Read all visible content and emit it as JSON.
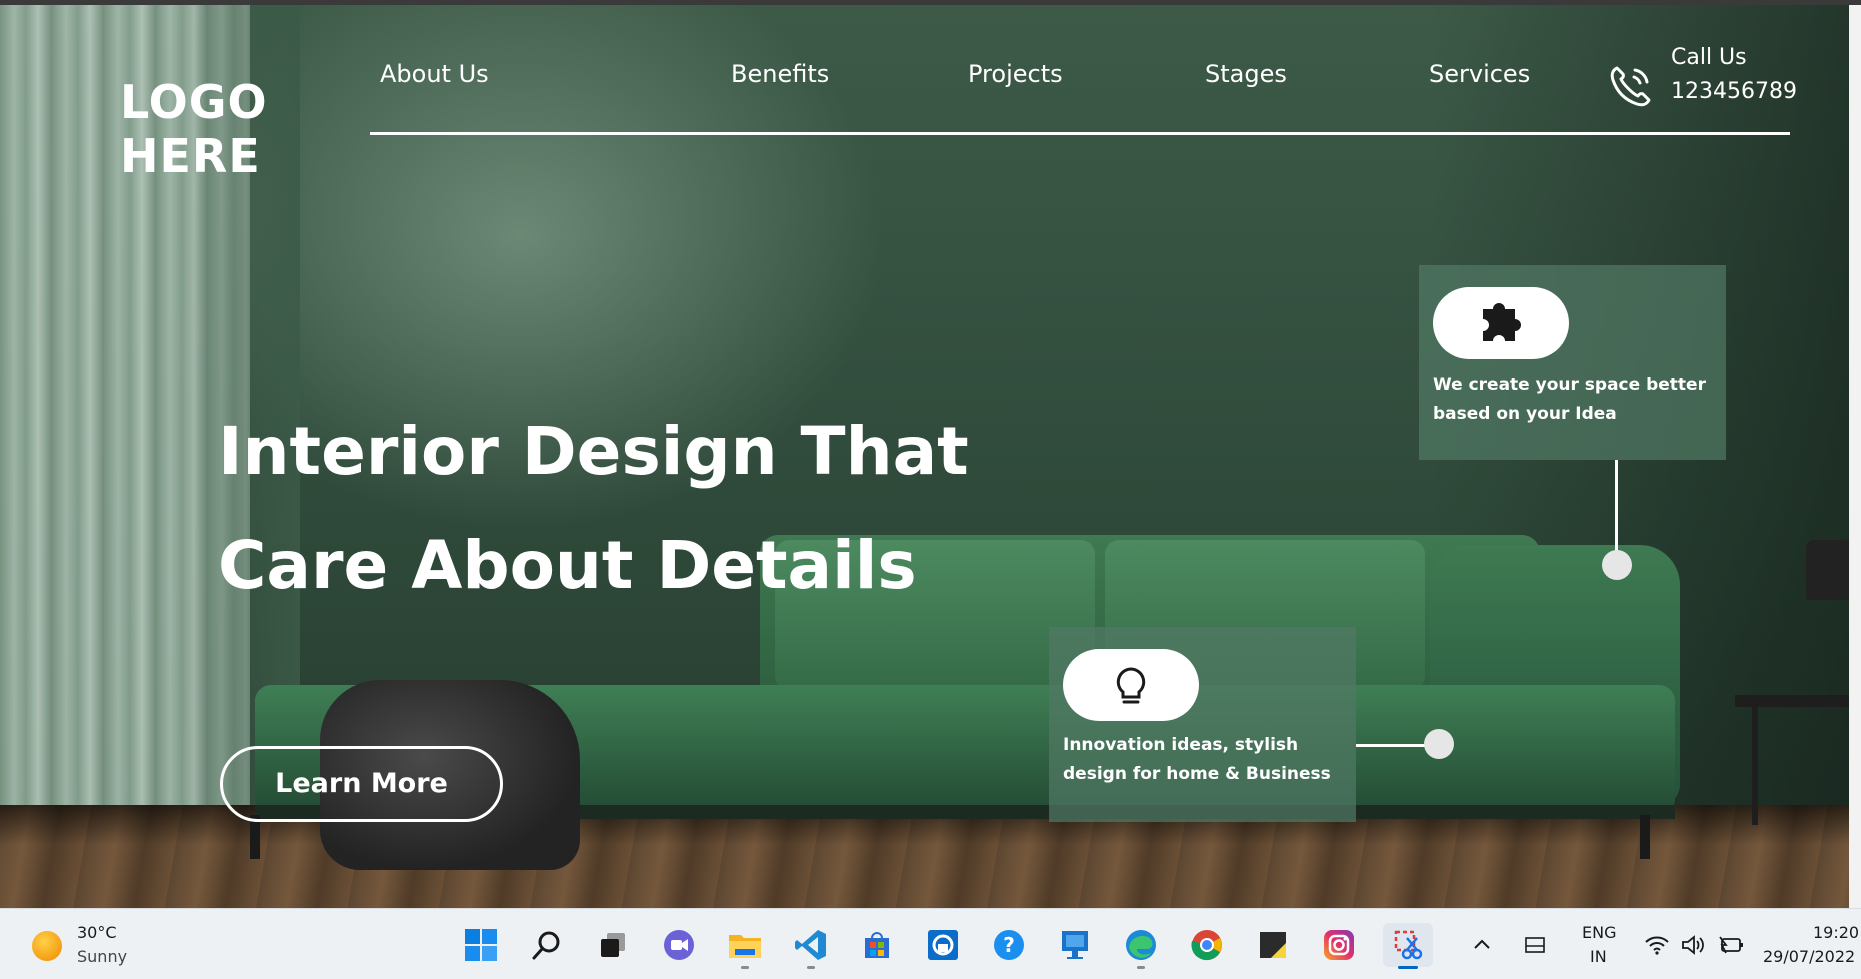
{
  "site": {
    "logo_line1": "LOGO",
    "logo_line2": "HERE",
    "nav": [
      {
        "label": "About Us"
      },
      {
        "label": "Benefits"
      },
      {
        "label": "Projects"
      },
      {
        "label": "Stages"
      },
      {
        "label": "Services"
      }
    ],
    "call": {
      "title": "Call Us",
      "number": "123456789",
      "icon": "phone-icon"
    },
    "headline_line1": "Interior Design That",
    "headline_line2": "Care About Details",
    "cta_label": "Learn More",
    "cards": [
      {
        "icon": "puzzle-icon",
        "text": "We create your space better based on your Idea"
      },
      {
        "icon": "lightbulb-icon",
        "text": "Innovation ideas, stylish design for home & Business"
      }
    ],
    "colors": {
      "accent_card": "#50786480",
      "text": "#ffffff",
      "hero_green": "#3d5a48"
    }
  },
  "taskbar": {
    "weather": {
      "temp": "30°C",
      "condition": "Sunny",
      "icon": "sun-icon"
    },
    "apps": [
      {
        "name": "start-icon"
      },
      {
        "name": "search-icon"
      },
      {
        "name": "task-view-icon"
      },
      {
        "name": "teams-chat-icon"
      },
      {
        "name": "file-explorer-icon"
      },
      {
        "name": "vscode-icon"
      },
      {
        "name": "microsoft-store-icon"
      },
      {
        "name": "remote-app-icon"
      },
      {
        "name": "help-icon"
      },
      {
        "name": "desktop-app-icon"
      },
      {
        "name": "edge-icon"
      },
      {
        "name": "chrome-icon"
      },
      {
        "name": "sticky-notes-icon"
      },
      {
        "name": "instagram-icon"
      },
      {
        "name": "snipping-tool-icon"
      }
    ],
    "tray": {
      "lang1": "ENG",
      "lang2": "IN"
    },
    "clock": {
      "time": "19:20",
      "date": "29/07/2022"
    }
  }
}
